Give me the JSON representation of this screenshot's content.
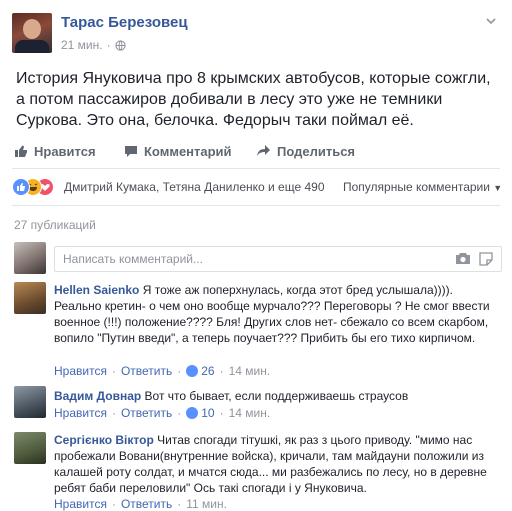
{
  "post": {
    "author": "Тарас Березовец",
    "time": "21 мин.",
    "text": "История Януковича про 8 крымских автобусов, которые сожгли, а потом пассажиров добивали в лесу это уже не темники Суркова. Это она, белочка. Федорыч таки поймал её."
  },
  "actions": {
    "like": "Нравится",
    "comment": "Комментарий",
    "share": "Поделиться"
  },
  "reactions": {
    "text": "Дмитрий Кумака, Тетяна Даниленко и еще 490",
    "sort": "Популярные комментарии"
  },
  "publications": "27 публикаций",
  "comment_input": {
    "placeholder": "Написать комментарий..."
  },
  "comments": [
    {
      "author": "Hellen Saienko",
      "text": "Я тоже аж поперхнулась, когда этот бред услышала)))). Реально кретин- о чем оно вообще мурчало??? Переговоры ? Не смог ввести военное (!!!) положение???? Бля! Других слов нет- сбежало со всем скарбом, вопило \"Путин введи\", а теперь поучает??? Прибить бы его тихо кирпичом.",
      "like": "Нравится",
      "reply": "Ответить",
      "likes": "26",
      "time": "14 мин."
    },
    {
      "author": "Вадим Довнар",
      "text": "Вот что бывает, если поддерживаешь страусов",
      "like": "Нравится",
      "reply": "Ответить",
      "likes": "10",
      "time": "14 мин."
    },
    {
      "author": "Сергієнко Віктор",
      "text": "Читав спогади тітушкі, як раз з цього приводу. \"мимо нас пробежали Вовани(внутренние войска), кричали, там майдауни положили из калашей роту солдат, и мчатся сюда... ми разбежались по лесу, но в деревне ребят баби переловили\" Ось такі спогади і у Януковича.",
      "like": "Нравится",
      "reply": "Ответить",
      "time": "11 мин."
    }
  ],
  "colors": {
    "link": "#365899",
    "muted": "#90949c",
    "like_blue": "#5890ff",
    "haha_yellow": "#f7b125",
    "love_red": "#f25268"
  }
}
